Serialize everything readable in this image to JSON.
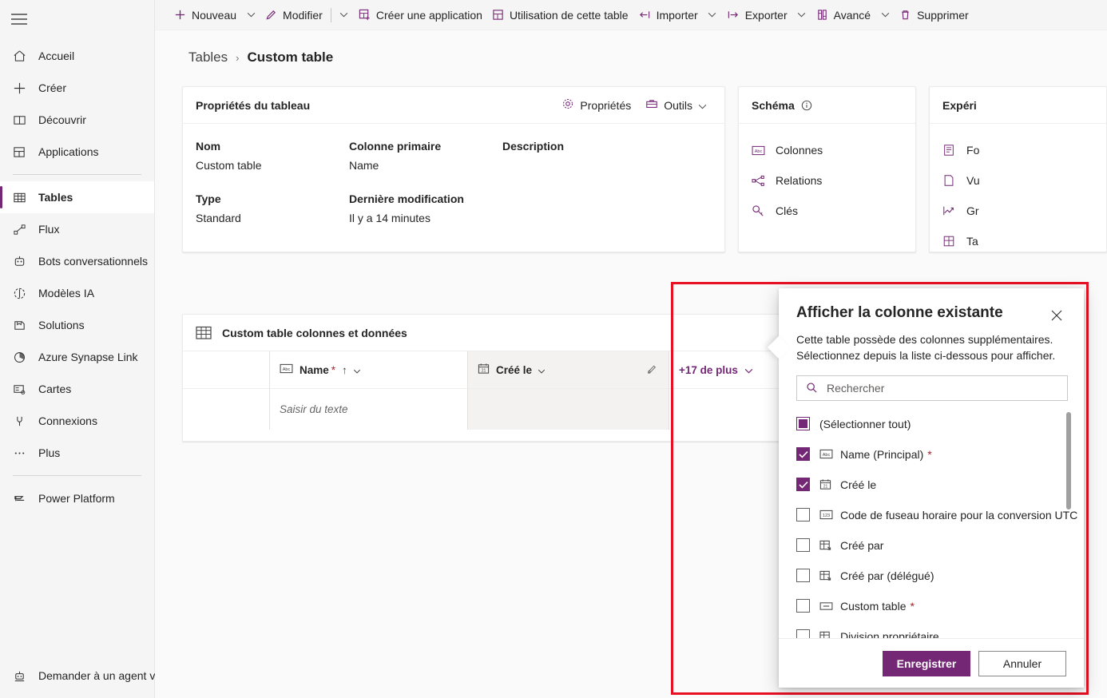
{
  "sidebar": {
    "hamburger": "menu-icon",
    "items": [
      {
        "label": "Accueil",
        "icon": "home-icon",
        "selected": false
      },
      {
        "label": "Créer",
        "icon": "plus-icon",
        "selected": false
      },
      {
        "label": "Découvrir",
        "icon": "book-icon",
        "selected": false
      },
      {
        "label": "Applications",
        "icon": "apps-icon",
        "selected": false
      },
      {
        "label": "Tables",
        "icon": "table-icon",
        "selected": true
      },
      {
        "label": "Flux",
        "icon": "flow-icon",
        "selected": false
      },
      {
        "label": "Bots conversationnels",
        "icon": "bot-icon",
        "selected": false
      },
      {
        "label": "Modèles IA",
        "icon": "ai-model-icon",
        "selected": false
      },
      {
        "label": "Solutions",
        "icon": "solutions-icon",
        "selected": false
      },
      {
        "label": "Azure Synapse Link",
        "icon": "synapse-icon",
        "selected": false
      },
      {
        "label": "Cartes",
        "icon": "cards-icon",
        "selected": false
      },
      {
        "label": "Connexions",
        "icon": "plug-icon",
        "selected": false
      },
      {
        "label": "Plus",
        "icon": "ellipsis-icon",
        "selected": false
      }
    ],
    "footer_item": {
      "label": "Power Platform",
      "icon": "power-platform-icon"
    },
    "bottom_item": {
      "label": "Demander à un agent virt",
      "icon": "virtual-agent-icon"
    }
  },
  "toolbar": {
    "commands": [
      {
        "label": "Nouveau",
        "icon": "plus-icon",
        "caret": true
      },
      {
        "label": "Modifier",
        "icon": "pencil-icon",
        "caret": true,
        "divider": true
      },
      {
        "label": "Créer une application",
        "icon": "app-icon",
        "caret": false
      },
      {
        "label": "Utilisation de cette table",
        "icon": "usage-icon",
        "caret": false
      },
      {
        "label": "Importer",
        "icon": "import-icon",
        "caret": true
      },
      {
        "label": "Exporter",
        "icon": "export-icon",
        "caret": true
      },
      {
        "label": "Avancé",
        "icon": "advanced-icon",
        "caret": true
      },
      {
        "label": "Supprimer",
        "icon": "trash-icon",
        "caret": false
      }
    ]
  },
  "breadcrumb": {
    "root": "Tables",
    "separator": "›",
    "current": "Custom table"
  },
  "properties_card": {
    "title": "Propriétés du tableau",
    "actions": [
      {
        "label": "Propriétés",
        "icon": "gear-icon",
        "caret": false
      },
      {
        "label": "Outils",
        "icon": "toolbox-icon",
        "caret": true
      }
    ],
    "fields": [
      {
        "label": "Nom",
        "value": "Custom table"
      },
      {
        "label": "Colonne primaire",
        "value": "Name"
      },
      {
        "label": "Description",
        "value": ""
      },
      {
        "label": "Type",
        "value": "Standard"
      },
      {
        "label": "Dernière modification",
        "value": "Il y a 14 minutes"
      },
      {
        "label": "",
        "value": ""
      }
    ]
  },
  "schema_card": {
    "title": "Schéma",
    "info_icon": "info-icon",
    "items": [
      {
        "label": "Colonnes",
        "icon": "abc-column-icon"
      },
      {
        "label": "Relations",
        "icon": "relations-icon"
      },
      {
        "label": "Clés",
        "icon": "key-icon"
      }
    ]
  },
  "experience_card": {
    "title": "Expéri",
    "items": [
      {
        "label": "Fo",
        "icon": "form-icon"
      },
      {
        "label": "Vu",
        "icon": "view-icon"
      },
      {
        "label": "Gr",
        "icon": "chart-icon"
      },
      {
        "label": "Ta",
        "icon": "dashboard-icon"
      }
    ]
  },
  "data_card": {
    "title": "Custom table colonnes et données",
    "icon": "grid-icon",
    "columns": [
      {
        "label": "Name",
        "icon": "abc-column-icon",
        "required": true,
        "sorted": true,
        "sort_arrow": "↑",
        "caret": true
      },
      {
        "label": "Créé le",
        "icon": "date-icon",
        "required": false,
        "sorted": false,
        "caret": true
      }
    ],
    "row_placeholder": "Saisir du texte",
    "more_chip": "+17 de plus",
    "edit_icon": "edit-column-icon"
  },
  "dialog": {
    "title": "Afficher la colonne existante",
    "close_icon": "close-icon",
    "description": "Cette table possède des colonnes supplémentaires. Sélectionnez depuis la liste ci-dessous pour afficher.",
    "search_placeholder": "Rechercher",
    "search_value": "",
    "search_icon": "search-icon",
    "options": [
      {
        "label": "(Sélectionner tout)",
        "state": "partial",
        "icon": null,
        "required": false
      },
      {
        "label": "Name (Principal)",
        "state": "checked",
        "icon": "abc-column-icon",
        "required": true
      },
      {
        "label": "Créé le",
        "state": "checked",
        "icon": "date-icon",
        "required": false
      },
      {
        "label": "Code de fuseau horaire pour la conversion UTC",
        "state": "unchecked",
        "icon": "number-icon",
        "required": false
      },
      {
        "label": "Créé par",
        "state": "unchecked",
        "icon": "lookup-icon",
        "required": false
      },
      {
        "label": "Créé par (délégué)",
        "state": "unchecked",
        "icon": "lookup-icon",
        "required": false
      },
      {
        "label": "Custom table",
        "state": "unchecked",
        "icon": "unique-id-icon",
        "required": true
      },
      {
        "label": "Division propriétaire",
        "state": "unchecked",
        "icon": "lookup-icon",
        "required": false
      }
    ],
    "save_label": "Enregistrer",
    "cancel_label": "Annuler"
  },
  "colors": {
    "accent": "#742774",
    "highlight": "#e81123",
    "required": "#a4262c"
  }
}
